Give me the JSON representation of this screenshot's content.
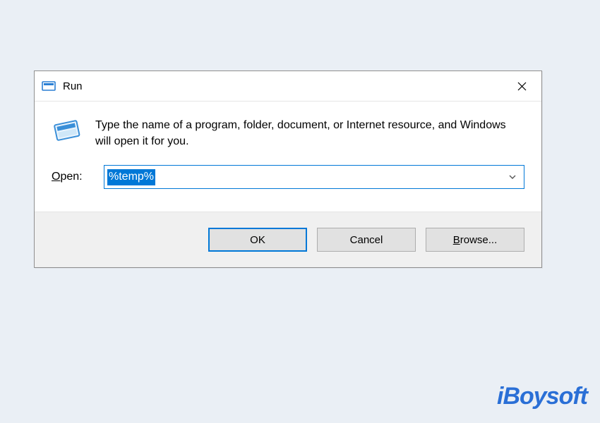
{
  "dialog": {
    "title": "Run",
    "description": "Type the name of a program, folder, document, or Internet resource, and Windows will open it for you.",
    "open_label_pre": "",
    "open_label_accel": "O",
    "open_label_post": "pen:",
    "input_value": "%temp%",
    "buttons": {
      "ok": "OK",
      "cancel": "Cancel",
      "browse_accel": "B",
      "browse_post": "rowse..."
    }
  },
  "watermark": "iBoysoft"
}
